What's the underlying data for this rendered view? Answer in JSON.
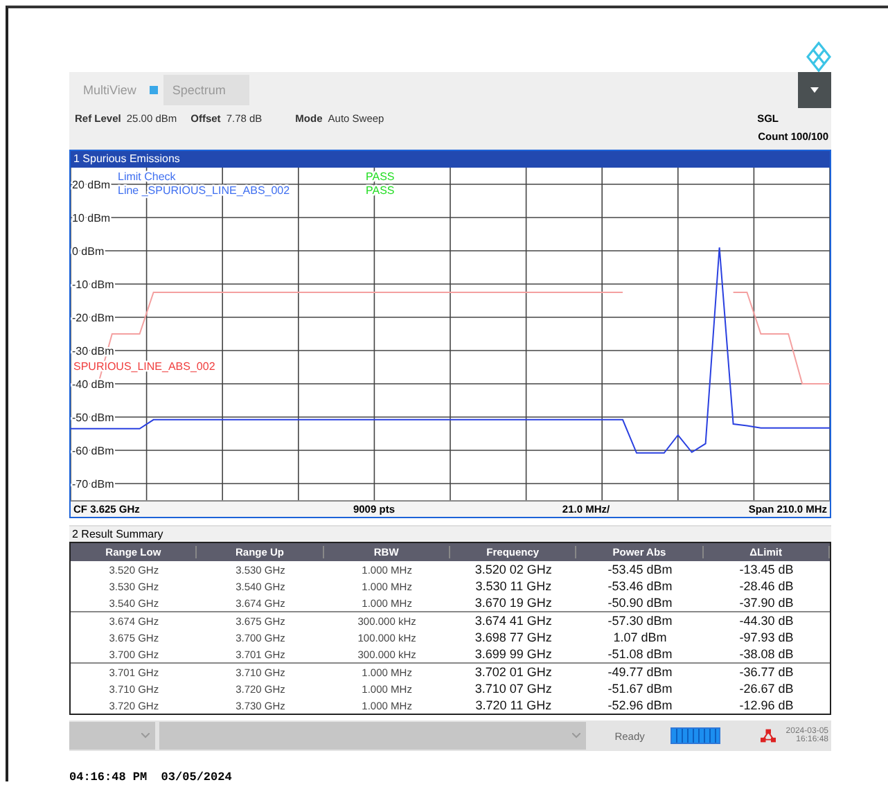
{
  "header": {
    "tabs": [
      {
        "label": "MultiView",
        "selected": false
      },
      {
        "label": "Spectrum",
        "selected": true
      }
    ],
    "info": [
      {
        "label": "Ref Level",
        "value": "25.00 dBm"
      },
      {
        "label": "Offset",
        "value": "7.78 dB"
      },
      {
        "label": "Mode",
        "value": "Auto Sweep"
      }
    ],
    "sweep_mode": "SGL",
    "count": "Count 100/100"
  },
  "chart_panel": {
    "title": "1 Spurious Emissions",
    "limit_check": [
      {
        "label": "Limit Check",
        "result": "PASS"
      },
      {
        "label": "Line _SPURIOUS_LINE_ABS_002",
        "result": "PASS"
      }
    ],
    "chart_data": {
      "type": "line",
      "ylim": [
        -75,
        25
      ],
      "grid": true,
      "categories": [
        null,
        null,
        null,
        null,
        null,
        null,
        null,
        null,
        null,
        null,
        null,
        null,
        null,
        null,
        null,
        null,
        null,
        null,
        null,
        null,
        null,
        null,
        null,
        null,
        null,
        null,
        null,
        null,
        null,
        null,
        null,
        null,
        null,
        null,
        null,
        null,
        null,
        null,
        null,
        null,
        null,
        null,
        null,
        null,
        null,
        null,
        null,
        null,
        null,
        null,
        null,
        null,
        null,
        null,
        null,
        null
      ],
      "yticks": [
        {
          "value": 20,
          "label": "20 dBm"
        },
        {
          "value": 10,
          "label": "10 dBm"
        },
        {
          "value": 0,
          "label": "0 dBm"
        },
        {
          "value": -10,
          "label": "-10 dBm"
        },
        {
          "value": -20,
          "label": "-20 dBm"
        },
        {
          "value": -30,
          "label": "-30 dBm"
        },
        {
          "value": -40,
          "label": "-40 dBm"
        },
        {
          "value": -50,
          "label": "-50 dBm"
        },
        {
          "value": -60,
          "label": "-60 dBm"
        },
        {
          "value": -70,
          "label": "-70 dBm"
        }
      ],
      "series": [
        {
          "color": "#2a40e0",
          "values": [
            -53.5,
            -53.5,
            -53.5,
            -53.5,
            -53.5,
            -53.5,
            -50.8,
            -50.8,
            -50.8,
            -50.8,
            -50.8,
            -50.8,
            -50.8,
            -50.8,
            -50.8,
            -50.8,
            -50.8,
            -50.8,
            -50.8,
            -50.8,
            -50.8,
            -50.8,
            -50.8,
            -50.8,
            -50.8,
            -50.8,
            -50.8,
            -50.8,
            -50.8,
            -50.8,
            -50.8,
            -50.8,
            -50.8,
            -50.8,
            -50.8,
            -50.8,
            -50.8,
            -50.8,
            -50.8,
            -50.8,
            -50.8,
            -60.8,
            -60.8,
            -60.8,
            -55.4,
            -60.6,
            -58,
            1,
            -52.1,
            -52.6,
            -53.3,
            -53.3,
            -53.3,
            -53.3,
            -53.3,
            -53.3
          ]
        },
        {
          "name": "SPURIOUS_LINE_ABS_002",
          "color": "#f4a0a0",
          "values": [
            -40,
            -40,
            -40,
            -25,
            -25,
            -25,
            -12.5,
            -12.5,
            -12.5,
            -12.5,
            -12.5,
            -12.5,
            -12.5,
            -12.5,
            -12.5,
            -12.5,
            -12.5,
            -12.5,
            -12.5,
            -12.5,
            -12.5,
            -12.5,
            -12.5,
            -12.5,
            -12.5,
            -12.5,
            -12.5,
            -12.5,
            -12.5,
            -12.5,
            -12.5,
            -12.5,
            -12.5,
            -12.5,
            -12.5,
            -12.5,
            -12.5,
            -12.5,
            -12.5,
            -12.5,
            -12.5,
            null,
            null,
            null,
            null,
            null,
            null,
            null,
            -12.5,
            -12.5,
            -25,
            -25,
            -25,
            -40,
            -40,
            -40
          ]
        }
      ]
    },
    "footer": [
      "CF 3.625 GHz",
      "9009 pts",
      "21.0 MHz/",
      "Span 210.0 MHz"
    ]
  },
  "result_summary": {
    "title": "2 Result Summary",
    "columns": [
      "Range Low",
      "Range Up",
      "RBW",
      "Frequency",
      "Power Abs",
      "ΔLimit"
    ],
    "row_groups": [
      {
        "rows": [
          [
            "3.520 GHz",
            "3.530 GHz",
            "1.000 MHz",
            "3.520 02 GHz",
            "-53.45 dBm",
            "-13.45 dB"
          ],
          [
            "3.530 GHz",
            "3.540 GHz",
            "1.000 MHz",
            "3.530 11 GHz",
            "-53.46 dBm",
            "-28.46 dB"
          ],
          [
            "3.540 GHz",
            "3.674 GHz",
            "1.000 MHz",
            "3.670 19 GHz",
            "-50.90 dBm",
            "-37.90 dB"
          ]
        ]
      },
      {
        "rows": [
          [
            "3.674 GHz",
            "3.675 GHz",
            "300.000 kHz",
            "3.674 41 GHz",
            "-57.30 dBm",
            "-44.30 dB"
          ],
          [
            "3.675 GHz",
            "3.700 GHz",
            "100.000 kHz",
            "3.698 77 GHz",
            "1.07 dBm",
            "-97.93 dB"
          ],
          [
            "3.700 GHz",
            "3.701 GHz",
            "300.000 kHz",
            "3.699 99 GHz",
            "-51.08 dBm",
            "-38.08 dB"
          ]
        ]
      },
      {
        "rows": [
          [
            "3.701 GHz",
            "3.710 GHz",
            "1.000 MHz",
            "3.702 01 GHz",
            "-49.77 dBm",
            "-36.77 dB"
          ],
          [
            "3.710 GHz",
            "3.720 GHz",
            "1.000 MHz",
            "3.710 07 GHz",
            "-51.67 dBm",
            "-26.67 dB"
          ],
          [
            "3.720 GHz",
            "3.730 GHz",
            "1.000 MHz",
            "3.720 11 GHz",
            "-52.96 dBm",
            "-12.96 dB"
          ]
        ]
      }
    ]
  },
  "status_bar": {
    "status": "Ready",
    "progress": {
      "level": 1
    },
    "date": "2024-03-05",
    "time": "16:16:48"
  },
  "timestamp": "04:16:48 PM  03/05/2024"
}
